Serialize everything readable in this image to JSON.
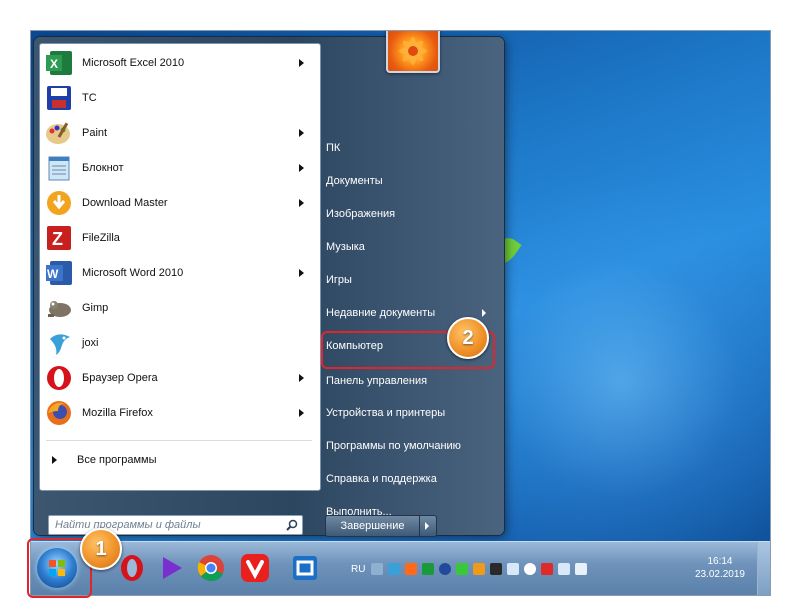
{
  "left_pane": {
    "programs": [
      {
        "label": "Microsoft Excel 2010",
        "icon": "excel-icon",
        "has_submenu": true
      },
      {
        "label": "TC",
        "icon": "total-commander-icon",
        "has_submenu": false
      },
      {
        "label": "Paint",
        "icon": "paint-icon",
        "has_submenu": true
      },
      {
        "label": "Блокнот",
        "icon": "notepad-icon",
        "has_submenu": true
      },
      {
        "label": "Download Master",
        "icon": "download-master-icon",
        "has_submenu": true
      },
      {
        "label": "FileZilla",
        "icon": "filezilla-icon",
        "has_submenu": false
      },
      {
        "label": "Microsoft Word 2010",
        "icon": "word-icon",
        "has_submenu": true
      },
      {
        "label": "Gimp",
        "icon": "gimp-icon",
        "has_submenu": false
      },
      {
        "label": "joxi",
        "icon": "joxi-icon",
        "has_submenu": false
      },
      {
        "label": "Браузер Opera",
        "icon": "opera-icon",
        "has_submenu": true
      },
      {
        "label": "Mozilla Firefox",
        "icon": "firefox-icon",
        "has_submenu": true
      }
    ],
    "all_programs": "Все программы"
  },
  "search": {
    "placeholder": "Найти программы и файлы"
  },
  "right_pane": {
    "items": [
      {
        "label": "ПК",
        "has_submenu": false
      },
      {
        "label": "Документы",
        "has_submenu": false
      },
      {
        "label": "Изображения",
        "has_submenu": false
      },
      {
        "label": "Музыка",
        "has_submenu": false
      },
      {
        "label": "Игры",
        "has_submenu": false
      },
      {
        "label": "Недавние документы",
        "has_submenu": true
      },
      {
        "label": "Компьютер",
        "has_submenu": false
      },
      {
        "label": "Панель управления",
        "has_submenu": false
      },
      {
        "label": "Устройства и принтеры",
        "has_submenu": false
      },
      {
        "label": "Программы по умолчанию",
        "has_submenu": false
      },
      {
        "label": "Справка и поддержка",
        "has_submenu": false
      },
      {
        "label": "Выполнить...",
        "has_submenu": false
      }
    ],
    "shutdown": "Завершение работы"
  },
  "badges": {
    "start": "1",
    "control_panel": "2"
  },
  "taskbar": {
    "pinned": [
      "opera-icon",
      "media-player-icon",
      "chrome-icon",
      "vivaldi-icon",
      "maxthon-icon"
    ],
    "language": "RU",
    "clock": {
      "time": "16:14",
      "date": "23.02.2019"
    }
  },
  "colors": {
    "highlight": "#e0262a",
    "badge": "#f0922a"
  }
}
